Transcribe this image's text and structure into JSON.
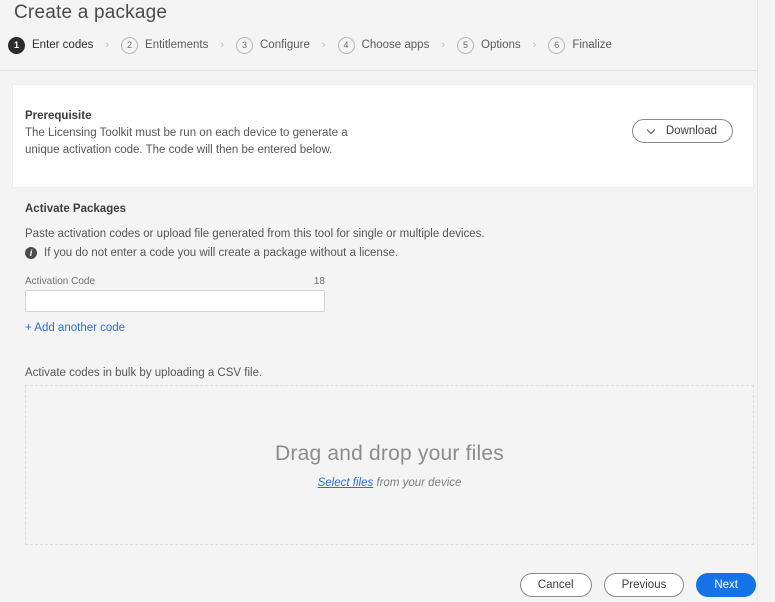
{
  "page": {
    "title": "Create a package"
  },
  "stepper": {
    "separator": "›",
    "steps": [
      {
        "number": "1",
        "label": "Enter codes",
        "active": true
      },
      {
        "number": "2",
        "label": "Entitlements",
        "active": false
      },
      {
        "number": "3",
        "label": "Configure",
        "active": false
      },
      {
        "number": "4",
        "label": "Choose apps",
        "active": false
      },
      {
        "number": "5",
        "label": "Options",
        "active": false
      },
      {
        "number": "6",
        "label": "Finalize",
        "active": false
      }
    ]
  },
  "prerequisite": {
    "title": "Prerequisite",
    "text": "The Licensing Toolkit must be run on each device to generate a unique activation code. The code will then be entered below.",
    "download_label": "Download"
  },
  "activate": {
    "title": "Activate Packages",
    "description": "Paste activation codes or upload file generated from this tool for single or multiple devices.",
    "note": "If you do not enter a code you will create a package without a license.",
    "note_icon": "info-icon",
    "code_label": "Activation Code",
    "code_counter": "18",
    "code_value": "",
    "code_placeholder": "",
    "add_another_label": "+ Add another code"
  },
  "bulk": {
    "description": "Activate codes in bulk by uploading a CSV file.",
    "dropzone_title": "Drag and drop your files",
    "select_link": "Select files",
    "select_suffix": " from your device"
  },
  "footer": {
    "cancel_label": "Cancel",
    "previous_label": "Previous",
    "next_label": "Next"
  },
  "colors": {
    "accent": "#1473e6",
    "link": "#2e6fcf",
    "page_background": "#f4f4f4",
    "card_background": "#ffffff",
    "active_step": "#2c2c2c"
  }
}
